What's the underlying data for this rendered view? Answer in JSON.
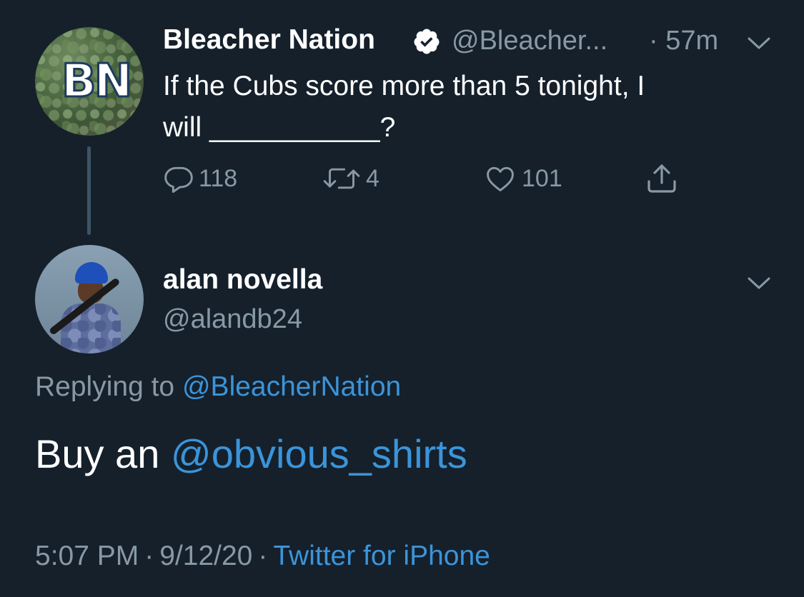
{
  "parent_tweet": {
    "avatar_text": "BN",
    "name": "Bleacher Nation",
    "verified_icon": "verified-badge-icon",
    "handle": "@Bleacher...",
    "time": "· 57m",
    "text": "If the Cubs score more than 5 tonight, I\nwill ___________?",
    "replies": "118",
    "retweets": "4",
    "likes": "101"
  },
  "reply_tweet": {
    "name": "alan novella",
    "handle": "@alandb24",
    "replying_prefix": "Replying to",
    "replying_to": "@BleacherNation",
    "text_prefix": "Buy an",
    "text_mention": "@obvious_shirts",
    "time": "5:07 PM",
    "date": "9/12/20",
    "source": "Twitter for iPhone",
    "separator": "·"
  },
  "colors": {
    "background": "#15202b",
    "secondary_text": "#8899a6",
    "link": "#3b94d9",
    "thread_line": "#3d5466"
  }
}
